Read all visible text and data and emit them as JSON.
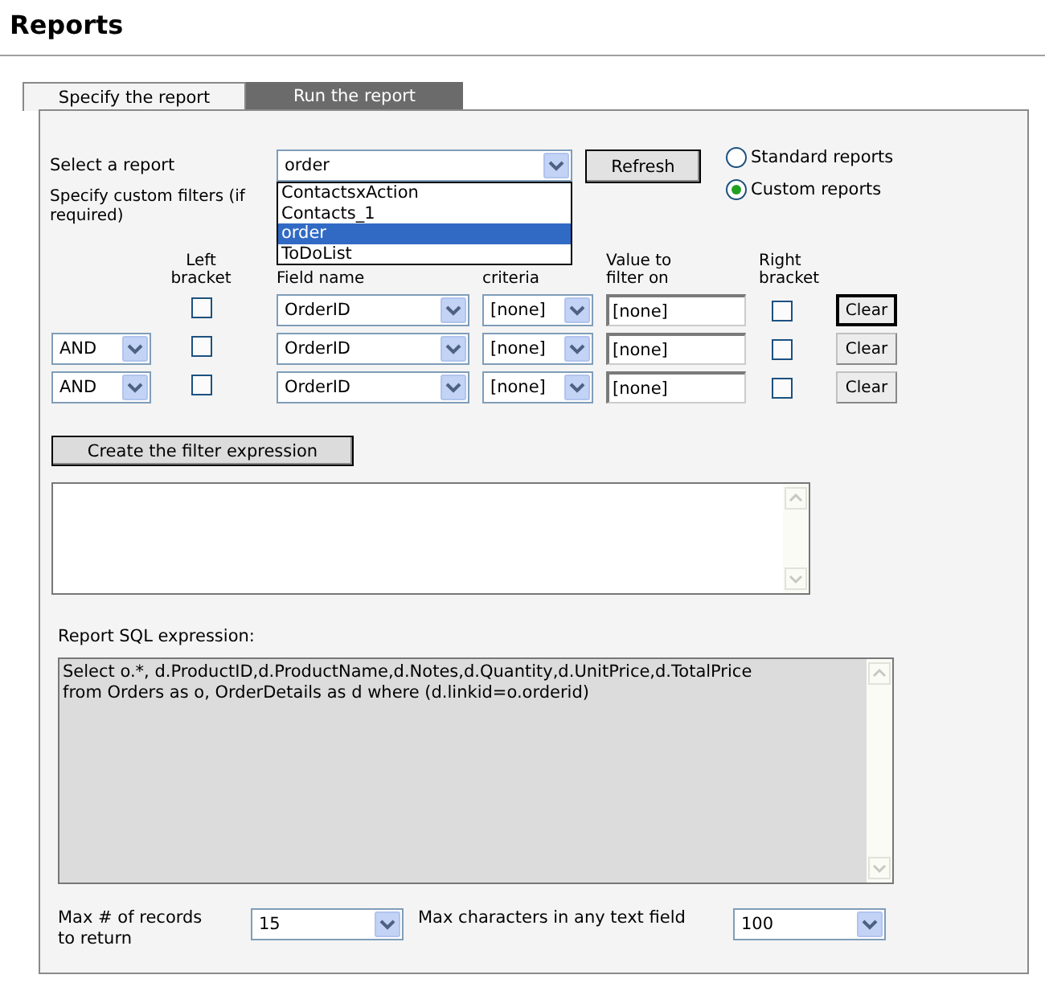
{
  "page": {
    "title": "Reports"
  },
  "tabs": [
    {
      "label": "Specify the report",
      "selected": true
    },
    {
      "label": "Run the report",
      "selected": false
    }
  ],
  "report_select": {
    "label": "Select a report",
    "value": "order",
    "expanded": true,
    "options": [
      {
        "label": "ContactsxAction",
        "selected": false
      },
      {
        "label": "Contacts_1",
        "selected": false
      },
      {
        "label": "order",
        "selected": true
      },
      {
        "label": "ToDoList",
        "selected": false
      }
    ]
  },
  "refresh_button": "Refresh",
  "report_types": [
    {
      "label": "Standard reports",
      "selected": false
    },
    {
      "label": "Custom reports",
      "selected": true
    }
  ],
  "custom_filters_label": "Specify custom filters (if required)",
  "filter_columns": [
    "Left bracket",
    "Field name",
    "criteria",
    "Value to filter on",
    "Right bracket"
  ],
  "filters": [
    {
      "left_bracket": false,
      "field": "OrderID",
      "criteria": "[none]",
      "value": "[none]",
      "right_bracket": false,
      "clear": "Clear",
      "focused": true
    },
    {
      "connector": "AND",
      "left_bracket": false,
      "field": "OrderID",
      "criteria": "[none]",
      "value": "[none]",
      "right_bracket": false,
      "clear": "Clear",
      "focused": false
    },
    {
      "connector": "AND",
      "left_bracket": false,
      "field": "OrderID",
      "criteria": "[none]",
      "value": "[none]",
      "right_bracket": false,
      "clear": "Clear",
      "focused": false
    }
  ],
  "create_button": "Create the filter expression",
  "sql": {
    "label": "Report SQL expression:",
    "value": "Select o.*, d.ProductID,d.ProductName,d.Notes,d.Quantity,d.UnitPrice,d.TotalPrice\nfrom Orders as o, OrderDetails as d where (d.linkid=o.orderid)"
  },
  "max_records": {
    "label": "Max # of records to return",
    "value": "15"
  },
  "max_chars": {
    "label": "Max characters in any text field",
    "value": "100"
  }
}
